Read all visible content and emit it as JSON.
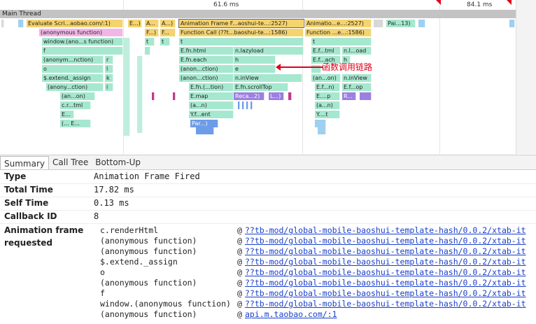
{
  "timeline": {
    "labels": [
      "61.6 ms",
      "84.1 ms"
    ],
    "track_title": "Main Thread",
    "frames": {
      "evaluate_script": "Evaluate Scri...aobao.com/:1)",
      "e_short": "E...)",
      "a_short1": "A...",
      "a_short2": "A...)",
      "anim_frame1": "Animation Frame F...aoshui-te...:2527)",
      "anim_frame2": "Animatio...e...:2527)",
      "pai": "Pai...13)",
      "anon_function": "(anonymous function)",
      "f_short1": "F...)",
      "f_short2": "F...",
      "function_call1": "Function Call (??t...baoshui-te...:1586)",
      "function_call2": "Function ...e...:1586)",
      "window_anon": "window.(ano...s function)",
      "t": "t",
      "f": "f",
      "o": "o",
      "anonym_nction": "(anonym...nction)",
      "r": "r",
      "l": "l",
      "k": "k",
      "i": "i",
      "extend_assign": "$.extend._assign",
      "anony_ction": "(anony...ction)",
      "an_on": "(an...on)",
      "c_tml": "c.r...tml",
      "e_dots": "E...",
      "paren_e": "(... E...",
      "efn_html": "E.fn.html",
      "n_lazyload": "n.lazyload",
      "efn_each": "E.fn.each",
      "h": "h",
      "anon_ction": "(anon...ction)",
      "e": "e",
      "n_inview": "n.inView",
      "efn_ction": "E.fn.(...tion)",
      "efn_scrolltop": "E.fn.scrollTop",
      "e_map": "E.map",
      "reca": "Reca...2)",
      "l_dots": "L...)",
      "an_n": "(a...n)",
      "y_ent": "Y.f...ent",
      "par": "Par...)",
      "ef_tml": "E.f...tml",
      "n_l_oad": "n.l...oad",
      "ef_ach": "E.f...ach",
      "an_ion": "(an...on)",
      "efn_short": "E.f...n)",
      "ef_op": "E.f...op",
      "e_p": "E....p",
      "r_cap": "R...",
      "y_t": "Y....t",
      "a_ction": "(a...ction)"
    },
    "annotation": "函数调用链路"
  },
  "tabs": [
    "Summary",
    "Call Tree",
    "Bottom-Up"
  ],
  "summary": {
    "type_label": "Type",
    "type_value": "Animation Frame Fired",
    "total_time_label": "Total Time",
    "total_time_value": "17.82 ms",
    "self_time_label": "Self Time",
    "self_time_value": "0.13 ms",
    "callback_id_label": "Callback ID",
    "callback_id_value": "8",
    "anim_requested_label": "Animation frame requested",
    "stack": [
      {
        "fn": "c.renderHtml",
        "url": "??tb-mod/global-mobile-baoshui-template-hash/0.0.2/xtab-it"
      },
      {
        "fn": "(anonymous function)",
        "url": "??tb-mod/global-mobile-baoshui-template-hash/0.0.2/xtab-it"
      },
      {
        "fn": "(anonymous function)",
        "url": "??tb-mod/global-mobile-baoshui-template-hash/0.0.2/xtab-it"
      },
      {
        "fn": "$.extend._assign",
        "url": "??tb-mod/global-mobile-baoshui-template-hash/0.0.2/xtab-it"
      },
      {
        "fn": "o",
        "url": "??tb-mod/global-mobile-baoshui-template-hash/0.0.2/xtab-it"
      },
      {
        "fn": "(anonymous function)",
        "url": "??tb-mod/global-mobile-baoshui-template-hash/0.0.2/xtab-it"
      },
      {
        "fn": "f",
        "url": "??tb-mod/global-mobile-baoshui-template-hash/0.0.2/xtab-it"
      },
      {
        "fn": "window.(anonymous function)",
        "url": "??tb-mod/global-mobile-baoshui-template-hash/0.0.2/xtab-it"
      },
      {
        "fn": "(anonymous function)",
        "url": "api.m.taobao.com/:1"
      }
    ],
    "at_symbol": "@"
  },
  "colors": {
    "annotation": "#e0001b",
    "link": "#1a3fc8",
    "marker": "#e0001b"
  }
}
